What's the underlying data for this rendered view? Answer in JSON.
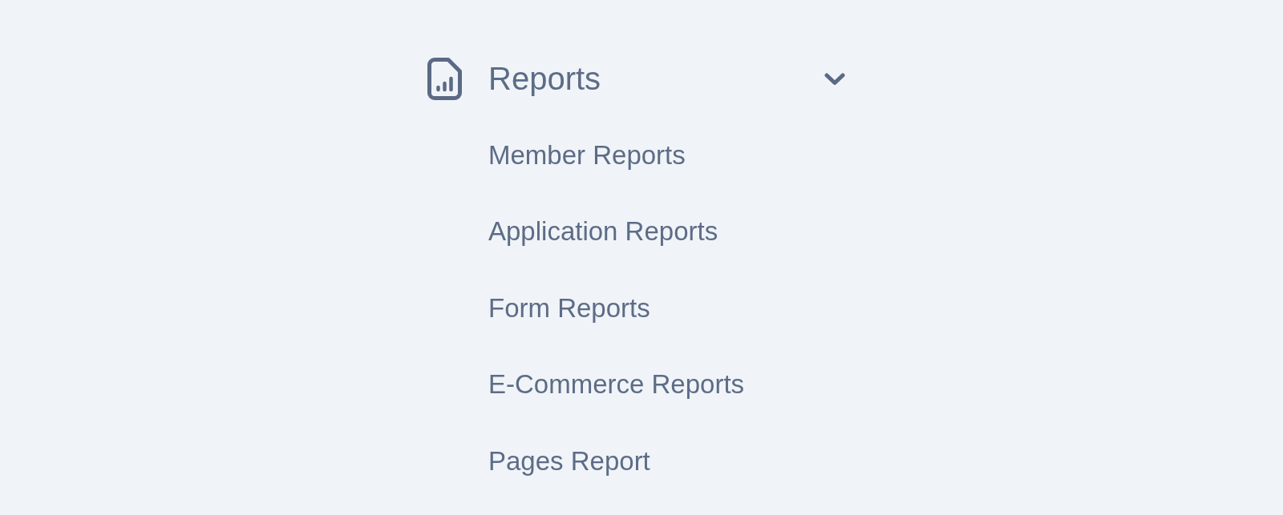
{
  "menu": {
    "label": "Reports",
    "expanded": true,
    "items": [
      {
        "label": "Member Reports"
      },
      {
        "label": "Application Reports"
      },
      {
        "label": "Form Reports"
      },
      {
        "label": "E-Commerce Reports"
      },
      {
        "label": "Pages Report"
      }
    ]
  }
}
